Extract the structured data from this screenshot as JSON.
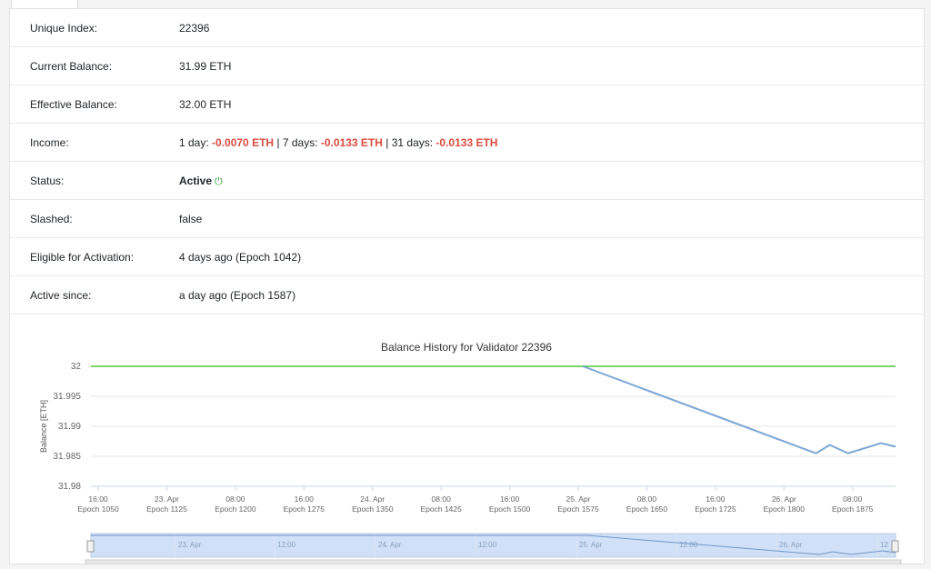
{
  "tabs": [
    {
      "label": ""
    },
    {
      "label": "",
      "badge": ""
    },
    {
      "label": "",
      "badge": ""
    }
  ],
  "details": {
    "unique_index": {
      "label": "Unique Index:",
      "value": "22396"
    },
    "current_balance": {
      "label": "Current Balance:",
      "value": "31.99 ETH"
    },
    "effective_balance": {
      "label": "Effective Balance:",
      "value": "32.00 ETH"
    },
    "income": {
      "label": "Income:",
      "day_label": "1 day: ",
      "day_value": "-0.0070 ETH",
      "week_label": " | 7 days: ",
      "week_value": "-0.0133 ETH",
      "month_label": " | 31 days: ",
      "month_value": "-0.0133 ETH"
    },
    "status": {
      "label": "Status:",
      "value": "Active",
      "icon": "power-icon"
    },
    "slashed": {
      "label": "Slashed:",
      "value": "false"
    },
    "eligible": {
      "label": "Eligible for Activation:",
      "value": "4 days ago (Epoch 1042)"
    },
    "active_since": {
      "label": "Active since:",
      "value": "a day ago (Epoch 1587)"
    }
  },
  "colors": {
    "negative": "#dc4c3f",
    "effective_line": "#7fd36d",
    "balance_line": "#7ba7d6",
    "navigator_fill": "#cfe0f7"
  },
  "chart_data": {
    "type": "line",
    "title": "Balance History for Validator 22396",
    "ylabel": "Balance [ETH]",
    "ylim": [
      31.98,
      32
    ],
    "yticks": [
      "32",
      "31.995",
      "31.99",
      "31.985",
      "31.98"
    ],
    "yvals": [
      32,
      31.995,
      31.99,
      31.985,
      31.98
    ],
    "xticks": [
      {
        "t": "16:00",
        "e": "Epoch 1050"
      },
      {
        "t": "23. Apr",
        "e": "Epoch 1125"
      },
      {
        "t": "08:00",
        "e": "Epoch 1200"
      },
      {
        "t": "16:00",
        "e": "Epoch 1275"
      },
      {
        "t": "24. Apr",
        "e": "Epoch 1350"
      },
      {
        "t": "08:00",
        "e": "Epoch 1425"
      },
      {
        "t": "16:00",
        "e": "Epoch 1500"
      },
      {
        "t": "25. Apr",
        "e": "Epoch 1575"
      },
      {
        "t": "08:00",
        "e": "Epoch 1650"
      },
      {
        "t": "16:00",
        "e": "Epoch 1725"
      },
      {
        "t": "26. Apr",
        "e": "Epoch 1800"
      },
      {
        "t": "08:00",
        "e": "Epoch 1875"
      }
    ],
    "xrange": [
      1042,
      1922
    ],
    "series": [
      {
        "name": "",
        "color": "#7fd36d",
        "points": [
          [
            1042,
            32
          ],
          [
            1922,
            32
          ]
        ]
      },
      {
        "name": "",
        "color": "#7ba7d6",
        "points": [
          [
            1580,
            32
          ],
          [
            1835,
            31.9855
          ],
          [
            1850,
            31.9869
          ],
          [
            1870,
            31.9855
          ],
          [
            1906,
            31.9872
          ],
          [
            1922,
            31.9866
          ]
        ]
      }
    ],
    "navigator_ticks": [
      "23. Apr",
      "12:00",
      "24. Apr",
      "12:00",
      "25. Apr",
      "12:00",
      "26. Apr",
      "12"
    ]
  }
}
